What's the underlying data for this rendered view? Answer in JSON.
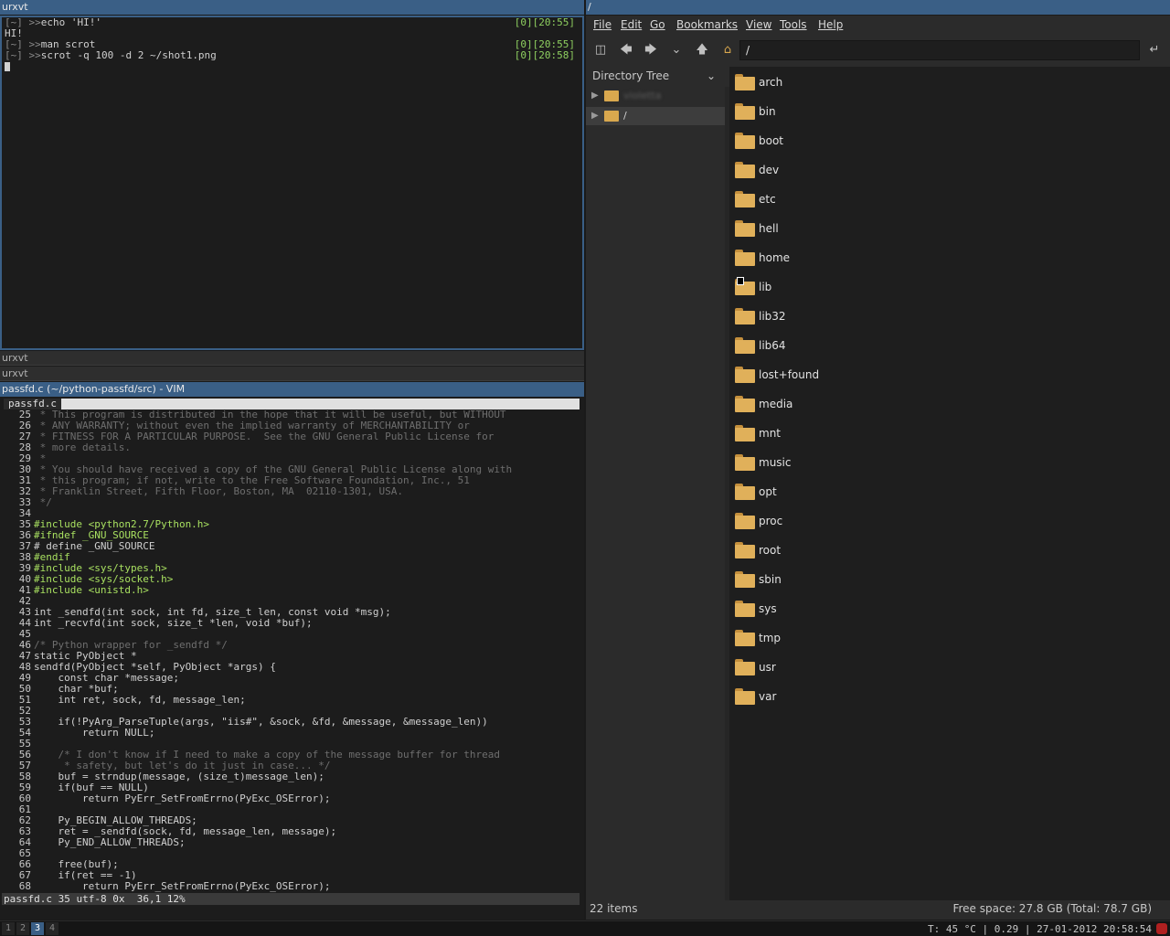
{
  "windows": {
    "terminal_title": "urxvt",
    "stack1_title": "urxvt",
    "stack2_title": "urxvt",
    "vim_title": "passfd.c (~/python-passfd/src) - VIM",
    "fm_title": "/"
  },
  "terminal": {
    "lines": [
      {
        "prompt": "[~] >>",
        "cmd": "echo 'HI!'",
        "time": "[0][20:55]"
      },
      {
        "output": "HI!"
      },
      {
        "prompt": "[~] >>",
        "cmd": "man scrot",
        "time": "[0][20:55]"
      },
      {
        "prompt": "[~] >>",
        "cmd": "scrot -q 100 -d 2 ~/shot1.png",
        "time": "[0][20:58]"
      }
    ]
  },
  "vim": {
    "tab": "passfd.c",
    "status": "passfd.c 35 utf-8 0x  36,1 12%",
    "lines": [
      {
        "n": "25",
        "t": " * This program is distributed in the hope that it will be useful, but WITHOUT",
        "c": "cm"
      },
      {
        "n": "26",
        "t": " * ANY WARRANTY; without even the implied warranty of MERCHANTABILITY or",
        "c": "cm"
      },
      {
        "n": "27",
        "t": " * FITNESS FOR A PARTICULAR PURPOSE.  See the GNU General Public License for",
        "c": "cm"
      },
      {
        "n": "28",
        "t": " * more details.",
        "c": "cm"
      },
      {
        "n": "29",
        "t": " *",
        "c": "cm"
      },
      {
        "n": "30",
        "t": " * You should have received a copy of the GNU General Public License along with",
        "c": "cm"
      },
      {
        "n": "31",
        "t": " * this program; if not, write to the Free Software Foundation, Inc., 51",
        "c": "cm"
      },
      {
        "n": "32",
        "t": " * Franklin Street, Fifth Floor, Boston, MA  02110-1301, USA.",
        "c": "cm"
      },
      {
        "n": "33",
        "t": " */",
        "c": "cm"
      },
      {
        "n": "34",
        "t": "",
        "c": ""
      },
      {
        "n": "35",
        "t": "#include <python2.7/Python.h>",
        "c": "pp"
      },
      {
        "n": "36",
        "t": "#ifndef _GNU_SOURCE",
        "c": "pp"
      },
      {
        "n": "37",
        "t": "# define _GNU_SOURCE",
        "c": ""
      },
      {
        "n": "38",
        "t": "#endif",
        "c": "pp"
      },
      {
        "n": "39",
        "t": "#include <sys/types.h>",
        "c": "pp"
      },
      {
        "n": "40",
        "t": "#include <sys/socket.h>",
        "c": "pp"
      },
      {
        "n": "41",
        "t": "#include <unistd.h>",
        "c": "pp"
      },
      {
        "n": "42",
        "t": "",
        "c": ""
      },
      {
        "n": "43",
        "t": "int _sendfd(int sock, int fd, size_t len, const void *msg);",
        "c": ""
      },
      {
        "n": "44",
        "t": "int _recvfd(int sock, size_t *len, void *buf);",
        "c": ""
      },
      {
        "n": "45",
        "t": "",
        "c": ""
      },
      {
        "n": "46",
        "t": "/* Python wrapper for _sendfd */",
        "c": "cm"
      },
      {
        "n": "47",
        "t": "static PyObject *",
        "c": ""
      },
      {
        "n": "48",
        "t": "sendfd(PyObject *self, PyObject *args) {",
        "c": ""
      },
      {
        "n": "49",
        "t": "    const char *message;",
        "c": ""
      },
      {
        "n": "50",
        "t": "    char *buf;",
        "c": ""
      },
      {
        "n": "51",
        "t": "    int ret, sock, fd, message_len;",
        "c": ""
      },
      {
        "n": "52",
        "t": "",
        "c": ""
      },
      {
        "n": "53",
        "t": "    if(!PyArg_ParseTuple(args, \"iis#\", &sock, &fd, &message, &message_len))",
        "c": ""
      },
      {
        "n": "54",
        "t": "        return NULL;",
        "c": ""
      },
      {
        "n": "55",
        "t": "",
        "c": ""
      },
      {
        "n": "56",
        "t": "    /* I don't know if I need to make a copy of the message buffer for thread",
        "c": "cm"
      },
      {
        "n": "57",
        "t": "     * safety, but let's do it just in case... */",
        "c": "cm"
      },
      {
        "n": "58",
        "t": "    buf = strndup(message, (size_t)message_len);",
        "c": ""
      },
      {
        "n": "59",
        "t": "    if(buf == NULL)",
        "c": ""
      },
      {
        "n": "60",
        "t": "        return PyErr_SetFromErrno(PyExc_OSError);",
        "c": ""
      },
      {
        "n": "61",
        "t": "",
        "c": ""
      },
      {
        "n": "62",
        "t": "    Py_BEGIN_ALLOW_THREADS;",
        "c": ""
      },
      {
        "n": "63",
        "t": "    ret = _sendfd(sock, fd, message_len, message);",
        "c": ""
      },
      {
        "n": "64",
        "t": "    Py_END_ALLOW_THREADS;",
        "c": ""
      },
      {
        "n": "65",
        "t": "",
        "c": ""
      },
      {
        "n": "66",
        "t": "    free(buf);",
        "c": ""
      },
      {
        "n": "67",
        "t": "    if(ret == -1)",
        "c": ""
      },
      {
        "n": "68",
        "t": "        return PyErr_SetFromErrno(PyExc_OSError);",
        "c": ""
      }
    ]
  },
  "file_manager": {
    "menus": [
      "File",
      "Edit",
      "Go",
      "Bookmarks",
      "View",
      "Tools",
      "Help"
    ],
    "location": "/",
    "sidebar_header": "Directory Tree",
    "tree": [
      {
        "label": "violetta",
        "blurred": true
      },
      {
        "label": "/",
        "blurred": false
      }
    ],
    "folders": [
      "arch",
      "bin",
      "boot",
      "dev",
      "etc",
      "hell",
      "home",
      "lib",
      "lib32",
      "lib64",
      "lost+found",
      "media",
      "mnt",
      "music",
      "opt",
      "proc",
      "root",
      "sbin",
      "sys",
      "tmp",
      "usr",
      "var"
    ],
    "item_count": "22 items",
    "free_space": "Free space: 27.8 GB (Total: 78.7 GB)",
    "folder_color": "#e0b05a"
  },
  "bar": {
    "workspaces": [
      "1",
      "2",
      "3",
      "4"
    ],
    "active_workspace": "3",
    "status": "T: 45 °C | 0.29 | 27-01-2012 20:58:54"
  }
}
